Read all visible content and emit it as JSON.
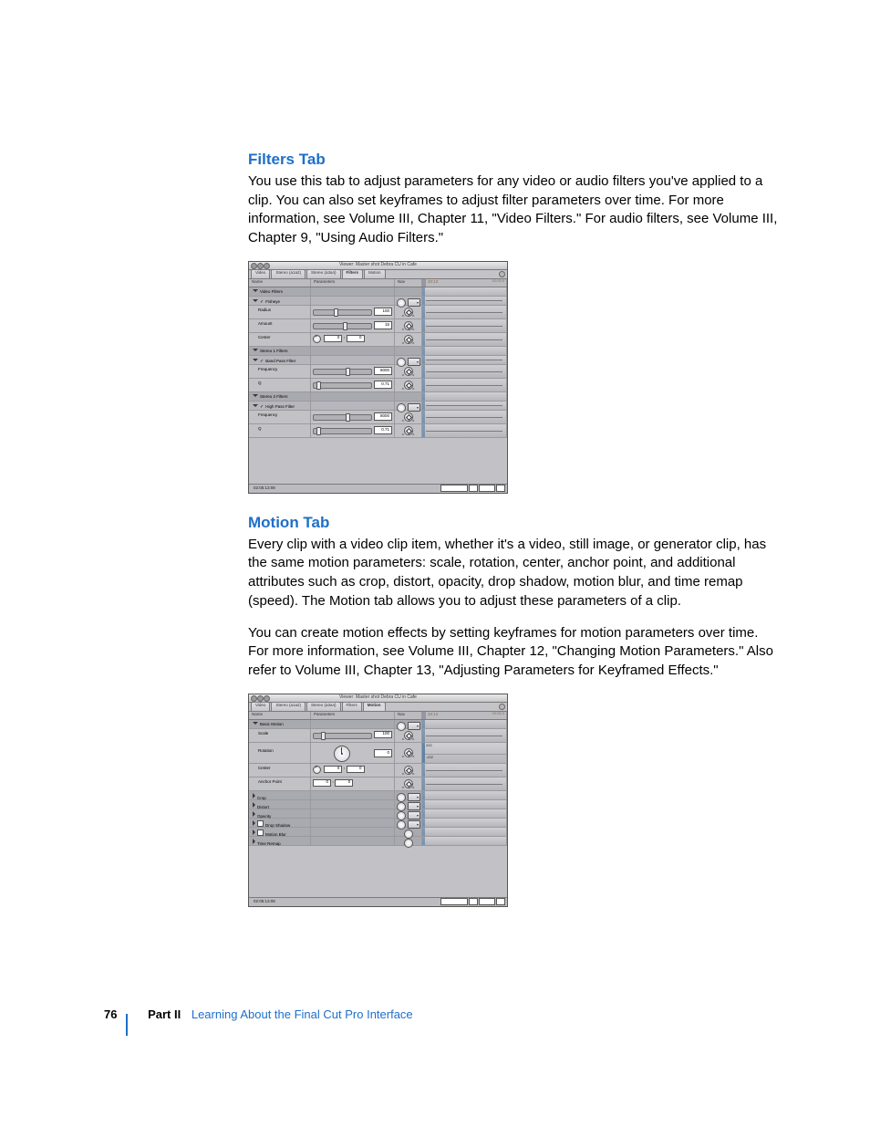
{
  "sections": {
    "filters": {
      "heading": "Filters Tab",
      "body": "You use this tab to adjust parameters for any video or audio filters you've applied to a clip. You can also set keyframes to adjust filter parameters over time. For more information, see Volume III, Chapter 11, \"Video Filters.\" For audio filters, see Volume III, Chapter 9, \"Using Audio Filters.\""
    },
    "motion": {
      "heading": "Motion Tab",
      "body1": "Every clip with a video clip item, whether it's a video, still image, or generator clip, has the same motion parameters:  scale, rotation, center, anchor point, and additional attributes such as crop, distort, opacity, drop shadow, motion blur, and time remap (speed). The Motion tab allows you to adjust these parameters of a clip.",
      "body2": "You can create motion effects by setting keyframes for motion parameters over time. For more information, see Volume III, Chapter 12, \"Changing Motion Parameters.\" Also refer to Volume III, Chapter 13, \"Adjusting Parameters for Keyframed Effects.\""
    }
  },
  "footer": {
    "page": "76",
    "part_label": "Part II",
    "part_name": "Learning About the Final Cut Pro Interface"
  },
  "viewer_common": {
    "title": "Viewer: Master shot Debra CU in Cafe",
    "tabs": [
      "Video",
      "Stereo (a1a2)",
      "Stereo (a3a4)",
      "Filters",
      "Motion"
    ],
    "columns": {
      "name": "Name",
      "parameters": "Parameters",
      "nav": "Nav"
    },
    "timeline_in": "33:13",
    "timeline_out": "02:03:3",
    "timecode": "02:05:13:08"
  },
  "filters_viewer": {
    "active_tab": "Filters",
    "groups": [
      {
        "label": "Video Filters",
        "effects": [
          {
            "label": "Fisheye",
            "params": [
              {
                "name": "Radius",
                "value": "100",
                "control": "slider",
                "thumb": 35
              },
              {
                "name": "Amount",
                "value": "15",
                "control": "slider",
                "thumb": 50
              },
              {
                "name": "Center",
                "value": [
                  "0",
                  "0"
                ],
                "control": "point"
              }
            ]
          }
        ]
      },
      {
        "label": "Stereo 1 Filters",
        "effects": [
          {
            "label": "Band Pass Filter",
            "params": [
              {
                "name": "Frequency",
                "value": "8000",
                "control": "slider",
                "thumb": 55
              },
              {
                "name": "Q",
                "value": "0.71",
                "control": "slider",
                "thumb": 5
              }
            ]
          }
        ]
      },
      {
        "label": "Stereo 2 Filters",
        "effects": [
          {
            "label": "High Pass Filter",
            "params": [
              {
                "name": "Frequency",
                "value": "8000",
                "control": "slider",
                "thumb": 55
              },
              {
                "name": "Q",
                "value": "0.71",
                "control": "slider",
                "thumb": 5
              }
            ]
          }
        ]
      }
    ]
  },
  "motion_viewer": {
    "active_tab": "Motion",
    "basic": {
      "label": "Basic Motion",
      "params": {
        "scale": {
          "name": "Scale",
          "value": "100",
          "thumb": 12
        },
        "rotation": {
          "name": "Rotation",
          "value": "0",
          "readout_top": "432",
          "readout_bot": "-432"
        },
        "center": {
          "name": "Center",
          "value": [
            "0",
            "0"
          ]
        },
        "anchor": {
          "name": "Anchor Point",
          "value": [
            "0",
            "0"
          ]
        }
      }
    },
    "collapsed": [
      {
        "label": "Crop",
        "menu": true
      },
      {
        "label": "Distort",
        "menu": true
      },
      {
        "label": "Opacity",
        "menu": true
      },
      {
        "label": "Drop Shadow",
        "menu": true,
        "checkbox": true
      },
      {
        "label": "Motion Blur",
        "menu": false,
        "checkbox": true
      },
      {
        "label": "Time Remap",
        "menu": false
      }
    ]
  }
}
